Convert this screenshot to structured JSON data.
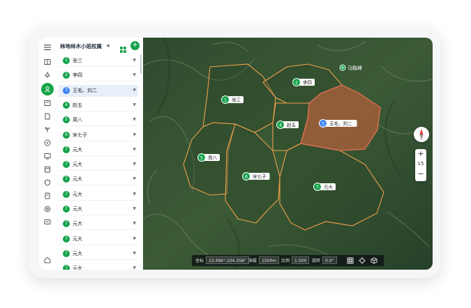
{
  "panel": {
    "title": "林地林木小班权属",
    "items": [
      {
        "num": "1",
        "name": "张三"
      },
      {
        "num": "2",
        "name": "李四"
      },
      {
        "num": "3",
        "name": "王毛、刘二"
      },
      {
        "num": "4",
        "name": "赵五"
      },
      {
        "num": "5",
        "name": "周八"
      },
      {
        "num": "6",
        "name": "宋七子"
      },
      {
        "num": "7",
        "name": "元大"
      },
      {
        "num": "7",
        "name": "元大"
      },
      {
        "num": "7",
        "name": "元大"
      },
      {
        "num": "7",
        "name": "元大"
      },
      {
        "num": "7",
        "name": "元大"
      },
      {
        "num": "7",
        "name": "元大"
      },
      {
        "num": "7",
        "name": "元大"
      },
      {
        "num": "7",
        "name": "元大"
      },
      {
        "num": "7",
        "name": "元大"
      }
    ]
  },
  "map": {
    "poi": "马鞍峰",
    "zoom": "15",
    "parcels": [
      {
        "num": "1",
        "name": "张三"
      },
      {
        "num": "2",
        "name": "李四"
      },
      {
        "num": "3",
        "name": "王毛、刘二"
      },
      {
        "num": "4",
        "name": "赵五"
      },
      {
        "num": "5",
        "name": "周八"
      },
      {
        "num": "6",
        "name": "宋七子"
      },
      {
        "num": "7",
        "name": "元大"
      }
    ]
  },
  "status": {
    "coord_label": "坐标",
    "coord_value": "23.496°,104.358°",
    "alt_label": "海拔",
    "alt_value": "1500m",
    "scale_label": "比例",
    "scale_value": "1:500",
    "rot_label": "旋转",
    "rot_value": "0.0°"
  },
  "colors": {
    "accent": "#16a34a",
    "selected": "#3b82f6",
    "boundary": "#f0a04b",
    "selected_fill": "#c0603a"
  },
  "icons": [
    "menu-icon",
    "layers-icon",
    "tree-icon",
    "user-land-icon",
    "book-icon",
    "document-icon",
    "plant-icon",
    "compass-icon",
    "chart-icon",
    "calendar-icon",
    "shield-icon",
    "file-icon",
    "settings-icon",
    "message-icon",
    "home-icon"
  ]
}
